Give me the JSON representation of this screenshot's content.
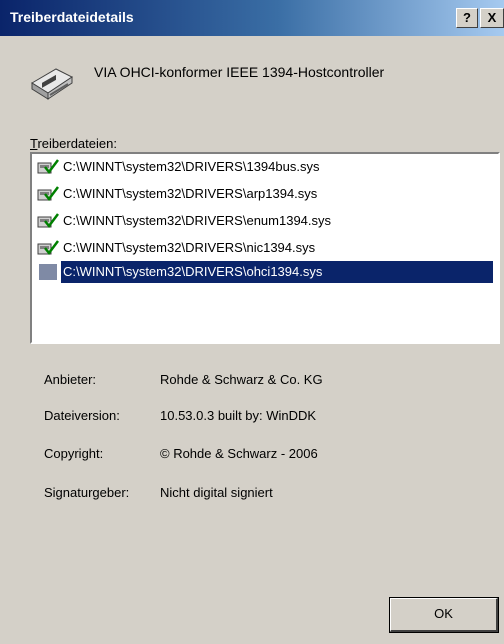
{
  "window": {
    "title": "Treiberdateidetails",
    "help_glyph": "?",
    "close_glyph": "X"
  },
  "device": {
    "icon": "controller-card-icon",
    "name": "VIA OHCI-konformer IEEE 1394-Hostcontroller"
  },
  "files": {
    "label_mnemonic": "T",
    "label_rest": "reiberdateien:",
    "items": [
      {
        "path": "C:\\WINNT\\system32\\DRIVERS\\1394bus.sys",
        "icon": "signed-driver-icon"
      },
      {
        "path": "C:\\WINNT\\system32\\DRIVERS\\arp1394.sys",
        "icon": "signed-driver-icon"
      },
      {
        "path": "C:\\WINNT\\system32\\DRIVERS\\enum1394.sys",
        "icon": "signed-driver-icon"
      },
      {
        "path": "C:\\WINNT\\system32\\DRIVERS\\nic1394.sys",
        "icon": "signed-driver-icon"
      },
      {
        "path": "C:\\WINNT\\system32\\DRIVERS\\ohci1394.sys",
        "icon": "unsigned-driver-icon",
        "selected": true
      }
    ]
  },
  "details": {
    "provider_label": "Anbieter:",
    "provider_value": "Rohde & Schwarz & Co. KG",
    "version_label": "Dateiversion:",
    "version_value": "10.53.0.3 built by: WinDDK",
    "copyright_label": "Copyright:",
    "copyright_value": "© Rohde & Schwarz - 2006",
    "signer_label": "Signaturgeber:",
    "signer_value": "Nicht digital signiert"
  },
  "buttons": {
    "ok_label": "OK"
  },
  "colors": {
    "title_bar": "#0a246a",
    "selection": "#0a246a",
    "dialog_bg": "#d4d0c8"
  }
}
